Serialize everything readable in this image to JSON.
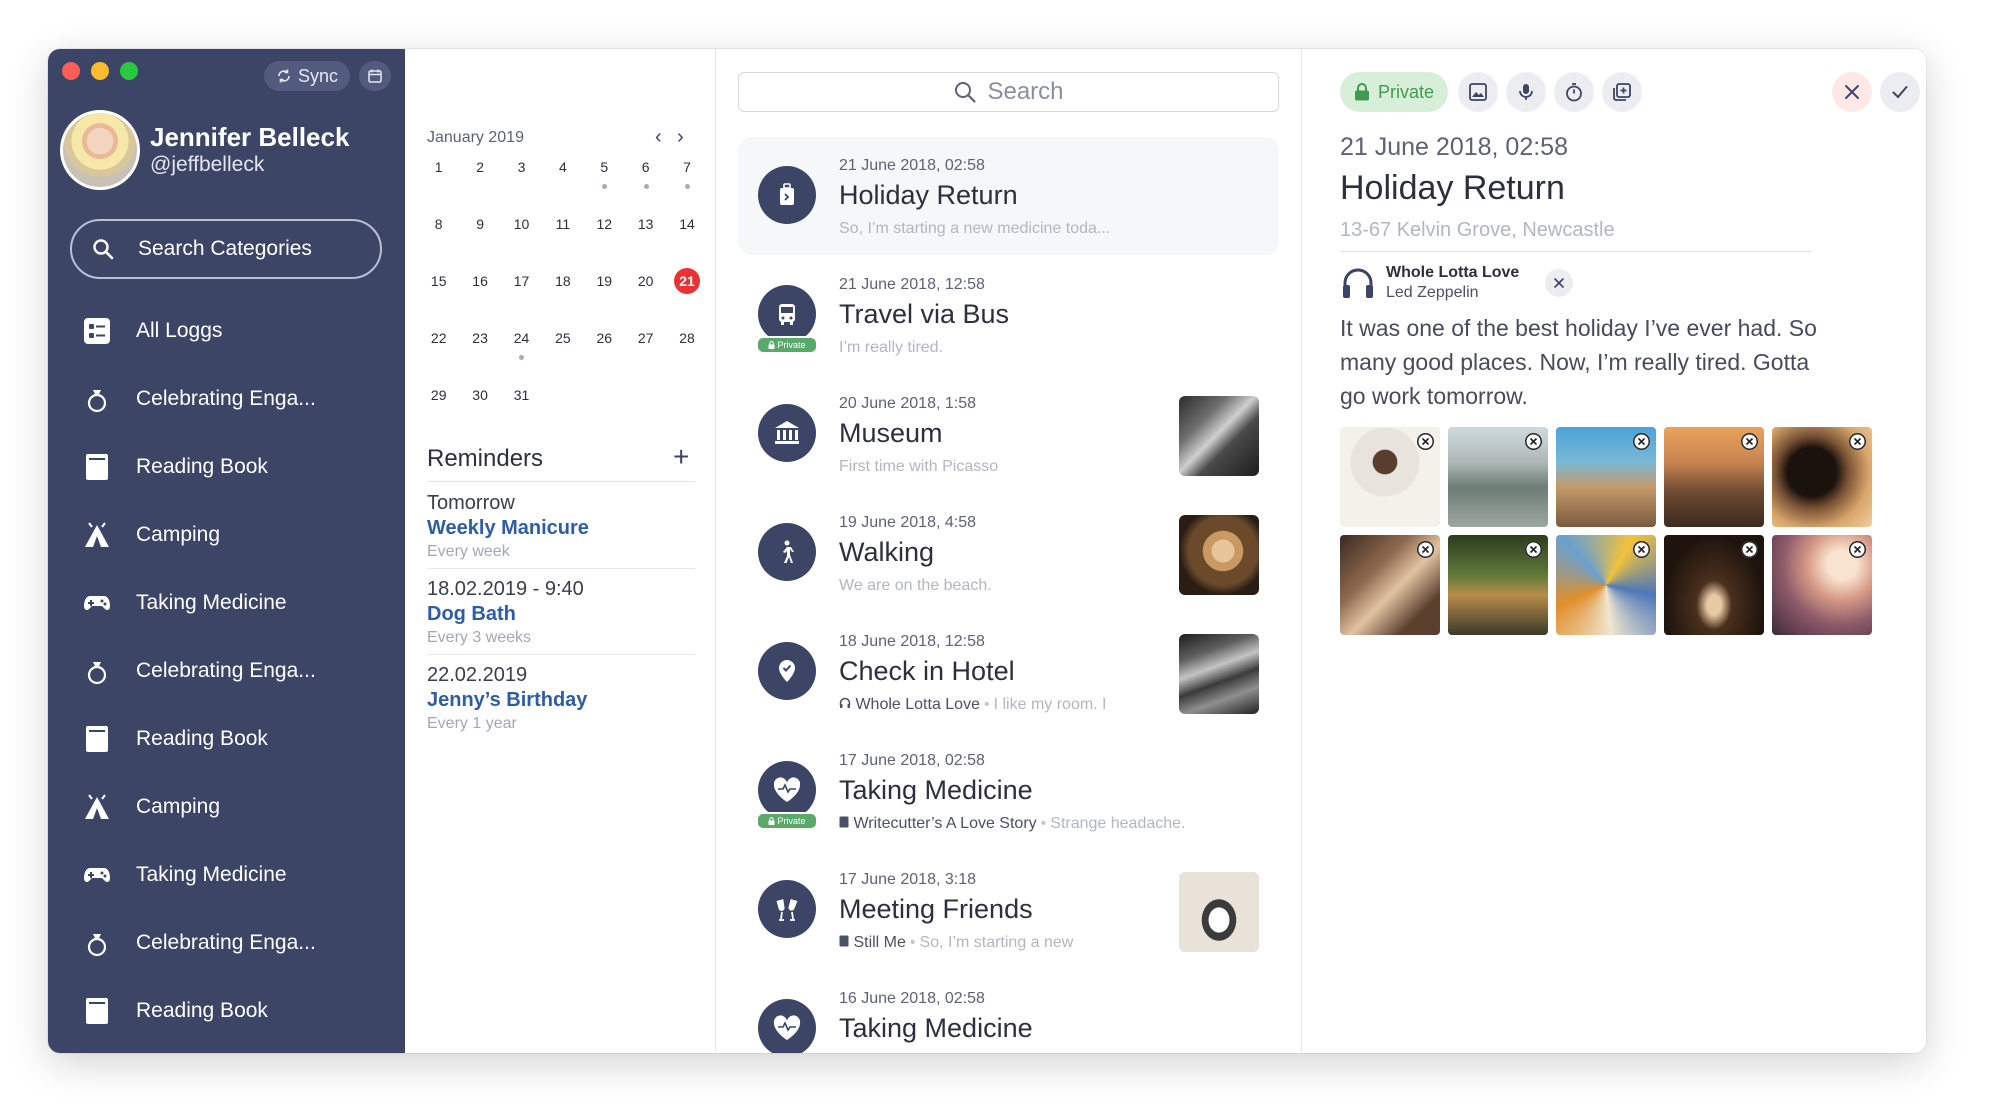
{
  "sidebar": {
    "sync_label": "Sync",
    "user_name": "Jennifer Belleck",
    "user_handle": "@jeffbelleck",
    "search_label": "Search Categories",
    "items": [
      {
        "label": "All Loggs",
        "icon": "list-icon"
      },
      {
        "label": "Celebrating Enga...",
        "icon": "ring-icon"
      },
      {
        "label": "Reading Book",
        "icon": "book-icon"
      },
      {
        "label": "Camping",
        "icon": "tent-icon"
      },
      {
        "label": "Taking Medicine",
        "icon": "gamepad-icon"
      },
      {
        "label": "Celebrating Enga...",
        "icon": "ring-icon"
      },
      {
        "label": "Reading Book",
        "icon": "book-icon"
      },
      {
        "label": "Camping",
        "icon": "tent-icon"
      },
      {
        "label": "Taking Medicine",
        "icon": "gamepad-icon"
      },
      {
        "label": "Celebrating Enga...",
        "icon": "ring-icon"
      },
      {
        "label": "Reading Book",
        "icon": "book-icon"
      }
    ]
  },
  "calendar": {
    "month": "January 2019",
    "today": 21,
    "days": [
      1,
      2,
      3,
      4,
      5,
      6,
      7,
      8,
      9,
      10,
      11,
      12,
      13,
      14,
      15,
      16,
      17,
      18,
      19,
      20,
      21,
      22,
      23,
      24,
      25,
      26,
      27,
      28,
      29,
      30,
      31
    ],
    "dot_days": [
      5,
      6,
      7,
      24
    ]
  },
  "reminders": {
    "title": "Reminders",
    "items": [
      {
        "when": "Tomorrow",
        "name": "Weekly Manicure",
        "freq": "Every week"
      },
      {
        "when": "18.02.2019 - 9:40",
        "name": "Dog Bath",
        "freq": "Every 3 weeks"
      },
      {
        "when": "22.02.2019",
        "name": "Jenny’s Birthday",
        "freq": "Every 1 year"
      }
    ]
  },
  "list": {
    "search_placeholder": "Search",
    "private_label": "Private",
    "entries": [
      {
        "date": "21 June 2018, 02:58",
        "title": "Holiday Return",
        "sub": "So, I’m starting a new medicine toda...",
        "icon": "luggage-icon"
      },
      {
        "date": "21 June 2018, 12:58",
        "title": "Travel via Bus",
        "sub": "I’m really tired.",
        "icon": "bus-icon"
      },
      {
        "date": "20 June 2018, 1:58",
        "title": "Museum",
        "sub": "First time with Picasso",
        "icon": "museum-icon"
      },
      {
        "date": "19 June 2018, 4:58",
        "title": "Walking",
        "sub": "We are on the beach.",
        "icon": "walking-icon"
      },
      {
        "date": "18 June 2018, 12:58",
        "title": "Check in Hotel",
        "meta": "Whole Lotta Love",
        "sub": "I like my room. I",
        "icon": "map-pin-icon"
      },
      {
        "date": "17 June 2018, 02:58",
        "title": "Taking Medicine",
        "meta": "Writecutter’s A Love Story",
        "sub": "Strange headache.",
        "icon": "heart-pulse-icon"
      },
      {
        "date": "17 June 2018, 3:18",
        "title": "Meeting Friends",
        "meta": "Still Me",
        "sub": "So, I’m starting a new",
        "icon": "cheers-icon"
      },
      {
        "date": "16 June  2018, 02:58",
        "title": "Taking Medicine",
        "sub": "",
        "icon": "heart-pulse-icon"
      }
    ]
  },
  "detail": {
    "private_label": "Private",
    "date": "21 June 2018, 02:58",
    "title": "Holiday Return",
    "location": "13-67 Kelvin Grove, Newcastle",
    "music_title": "Whole Lotta Love",
    "music_artist": "Led Zeppelin",
    "body": "It was one of the best holiday I’ve ever had. So many good places. Now, I’m really tired. Gotta go work tomorrow."
  },
  "colors": {
    "sidebar_bg": "#3d4566",
    "accent_blue": "#2e5ca8",
    "private_green": "#3f9b51",
    "today_red": "#ea3232"
  }
}
